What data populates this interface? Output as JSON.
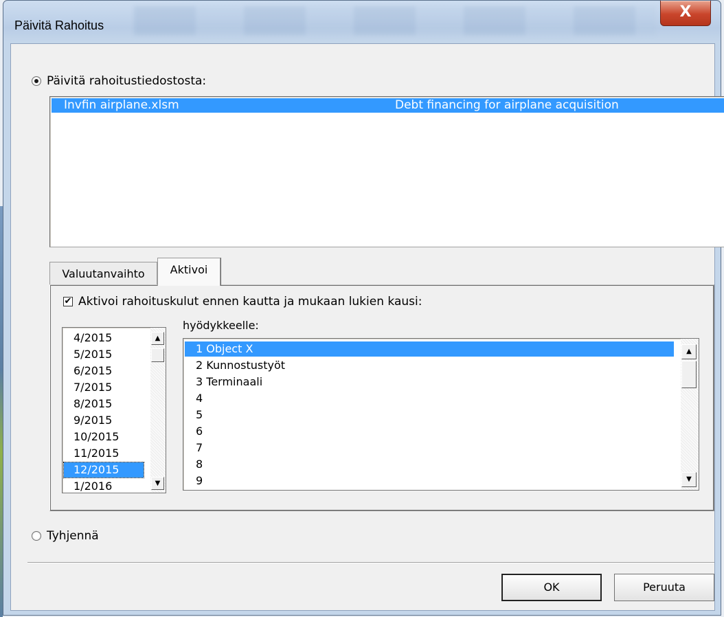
{
  "window": {
    "title": "Päivitä Rahoitus",
    "close_label": "X"
  },
  "update_from_file": {
    "label": "Päivitä rahoitustiedostosta:",
    "selected": true,
    "files": [
      {
        "name": "Invfin airplane.xlsm",
        "description": "Debt financing for airplane acquisition",
        "selected": true
      }
    ]
  },
  "tabs": [
    {
      "label": "Valuutanvaihto",
      "active": false
    },
    {
      "label": "Aktivoi",
      "active": true
    }
  ],
  "activate": {
    "checkbox_label": "Aktivoi rahoituskulut ennen kautta ja mukaan lukien kausi:",
    "checked": true,
    "periods": [
      "4/2015",
      "5/2015",
      "6/2015",
      "7/2015",
      "8/2015",
      "9/2015",
      "10/2015",
      "11/2015",
      "12/2015",
      "1/2016"
    ],
    "selected_period": "12/2015",
    "asset_label": "hyödykkeelle:",
    "assets": [
      "1 Object X",
      "2 Kunnostustyöt",
      "3 Terminaali",
      "4",
      "5",
      "6",
      "7",
      "8",
      "9"
    ],
    "selected_asset": "1 Object X"
  },
  "clear": {
    "label": "Tyhjennä",
    "selected": false
  },
  "buttons": {
    "ok": "OK",
    "cancel": "Peruuta"
  },
  "icons": {
    "radio": "radio-button",
    "checkbox_mark": "✔",
    "scroll_up": "▲",
    "scroll_down": "▼"
  }
}
